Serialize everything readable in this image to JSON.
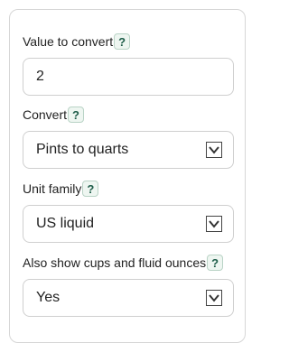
{
  "fields": [
    {
      "label": "Value to convert",
      "help": "?",
      "value": "2"
    },
    {
      "label": "Convert",
      "help": "?",
      "value": "Pints to quarts"
    },
    {
      "label": "Unit family",
      "help": "?",
      "value": "US liquid"
    },
    {
      "label": "Also show cups and fluid ounces",
      "help": "?",
      "value": "Yes"
    }
  ],
  "icons": {
    "help": "help-icon",
    "dropdown": "chevron-down-icon"
  }
}
